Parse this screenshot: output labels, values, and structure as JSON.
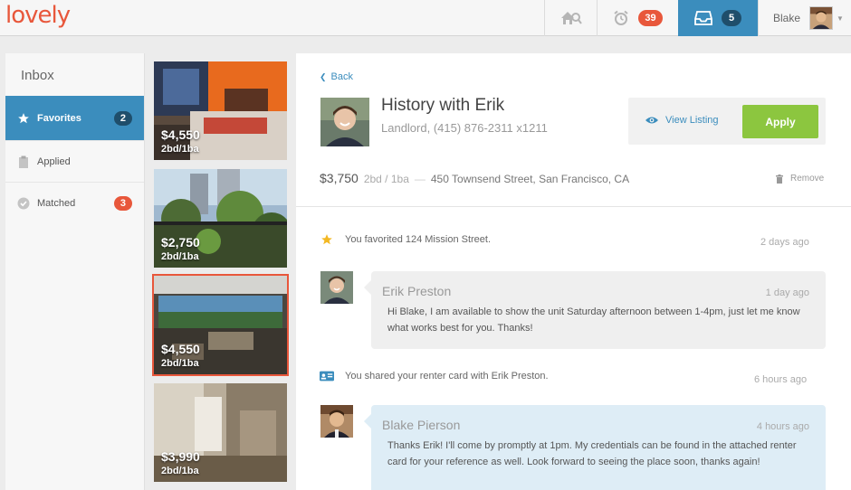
{
  "app": {
    "logo": "lovely"
  },
  "topnav": {
    "alarm_count": "39",
    "inbox_count": "5",
    "user_name": "Blake"
  },
  "sidebar": {
    "title": "Inbox",
    "items": [
      {
        "label": "Favorites",
        "count": "2",
        "icon": "star-icon"
      },
      {
        "label": "Applied",
        "count": "",
        "icon": "clipboard-icon"
      },
      {
        "label": "Matched",
        "count": "3",
        "icon": "check-circle-icon"
      }
    ]
  },
  "listings": [
    {
      "price": "$4,550",
      "beds": "2bd/1ba"
    },
    {
      "price": "$2,750",
      "beds": "2bd/1ba"
    },
    {
      "price": "$4,550",
      "beds": "2bd/1ba"
    },
    {
      "price": "$3,990",
      "beds": "2bd/1ba"
    }
  ],
  "detail": {
    "back_label": "Back",
    "title": "History with Erik",
    "subtitle": "Landlord, (415) 876-2311 x1211",
    "view_listing_label": "View Listing",
    "apply_label": "Apply",
    "price": "$3,750",
    "beds": "2bd / 1ba",
    "separator": "—",
    "address": "450 Townsend Street, San Francisco, CA",
    "remove_label": "Remove"
  },
  "timeline": {
    "event1": {
      "text": "You favorited 124 Mission Street.",
      "time": "2 days ago"
    },
    "message1": {
      "name": "Erik Preston",
      "time": "1 day ago",
      "text": "Hi Blake, I am available to show the unit Saturday afternoon between 1-4pm, just let me know what works best for you. Thanks!"
    },
    "event2": {
      "text": "You shared your renter card with Erik Preston.",
      "time": "6 hours ago"
    },
    "message2": {
      "name": "Blake Pierson",
      "time": "4 hours ago",
      "text": "Thanks Erik! I'll come by promptly at 1pm. My credentials can be found in the attached renter card for your reference as well. Look forward to seeing the place soon, thanks again!"
    }
  },
  "colors": {
    "brand": "#e8573b",
    "accent": "#3b8dbd",
    "apply": "#8cc63f"
  }
}
